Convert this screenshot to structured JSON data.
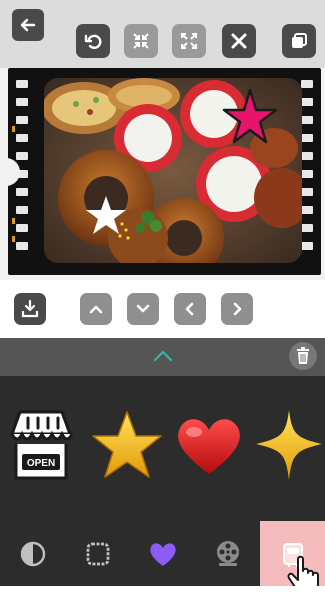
{
  "toolbar": {
    "back_icon": "arrow-left-icon",
    "buttons": [
      {
        "name": "undo-button",
        "icon": "undo-icon"
      },
      {
        "name": "shrink-button",
        "icon": "compress-icon"
      },
      {
        "name": "expand-button",
        "icon": "expand-icon"
      },
      {
        "name": "delete-sticker-button",
        "icon": "close-icon"
      },
      {
        "name": "duplicate-button",
        "icon": "copy-icon"
      }
    ]
  },
  "photo": {
    "filter": "film-strip",
    "stickers": [
      "pink-star",
      "white-star"
    ]
  },
  "controls": {
    "buttons": [
      "save-icon",
      "chevron-up-icon",
      "chevron-down-icon",
      "chevron-left-icon",
      "chevron-right-icon"
    ]
  },
  "panel": {
    "collapse_icon": "chevron-up-icon",
    "trash_icon": "trash-icon"
  },
  "sticker_sheet": {
    "items": [
      {
        "name": "open-shop-sticker",
        "text": "OPEN"
      },
      {
        "name": "gold-star-sticker",
        "text": ""
      },
      {
        "name": "red-heart-sticker",
        "text": ""
      },
      {
        "name": "gold-sparkle-sticker",
        "text": ""
      }
    ]
  },
  "tabs": {
    "items": [
      "contrast-icon",
      "frame-icon",
      "heart-icon",
      "film-reel-icon",
      "sticker-icon"
    ],
    "active": "sticker-icon"
  },
  "colors": {
    "accent_teal": "#35b6a8",
    "active_tab": "#f4bcbc",
    "panel_dark": "#2c2c2c",
    "heart_purple": "#8b5cf6"
  }
}
